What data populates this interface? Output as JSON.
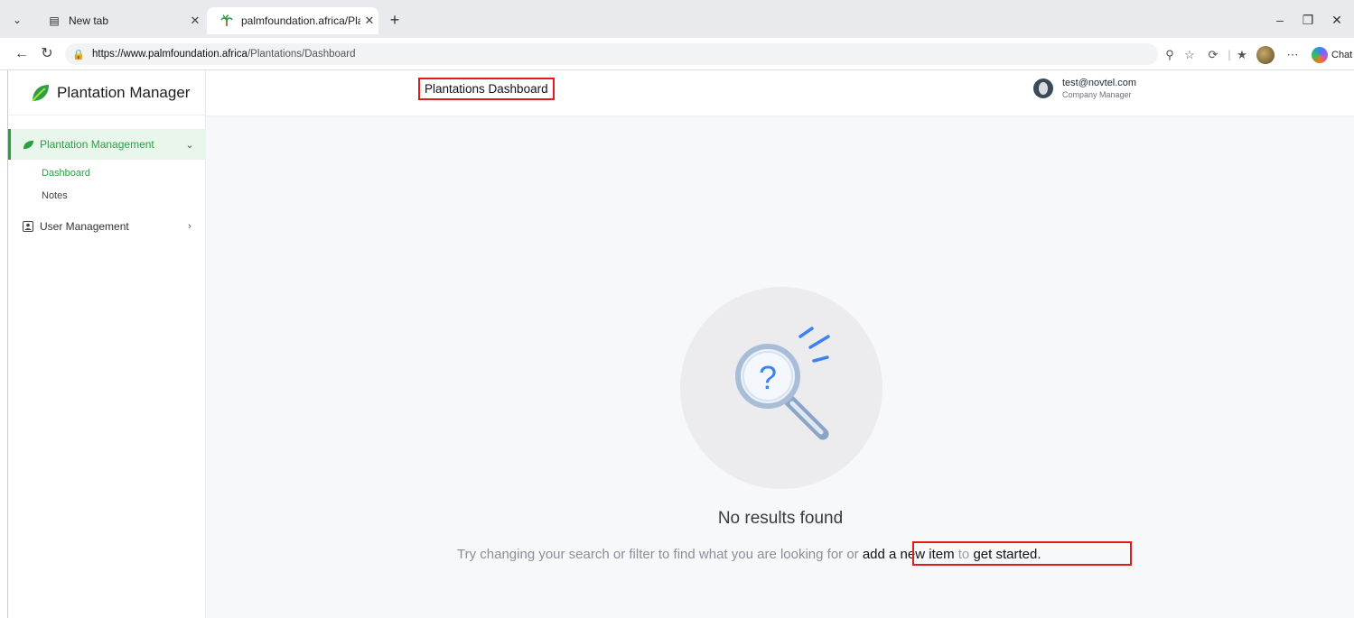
{
  "browser": {
    "tabs": [
      {
        "title": "New tab",
        "active": false
      },
      {
        "title": "palmfoundation.africa/Plantations/",
        "active": true
      }
    ],
    "url": {
      "host": "https://www.palmfoundation.africa",
      "path": "/Plantations/Dashboard"
    },
    "chat_label": "Chat"
  },
  "app": {
    "brand": "Plantation Manager",
    "brand_color": "#2e9d46",
    "sidebar": {
      "groups": [
        {
          "label": "Plantation Management",
          "icon": "leaf-icon",
          "expanded": true,
          "items": [
            {
              "label": "Dashboard",
              "active": true
            },
            {
              "label": "Notes",
              "active": false
            }
          ]
        },
        {
          "label": "User Management",
          "icon": "user-card-icon",
          "expanded": false
        }
      ]
    },
    "header": {
      "title": "Plantations Dashboard",
      "user_email": "test@novtel.com",
      "user_role": "Company Manager"
    },
    "empty_state": {
      "title": "No results found",
      "description_prefix": "Try changing your search or filter to find what you are looking for or",
      "link_add": "add a new item",
      "connector": "to",
      "link_start": "get started."
    }
  }
}
